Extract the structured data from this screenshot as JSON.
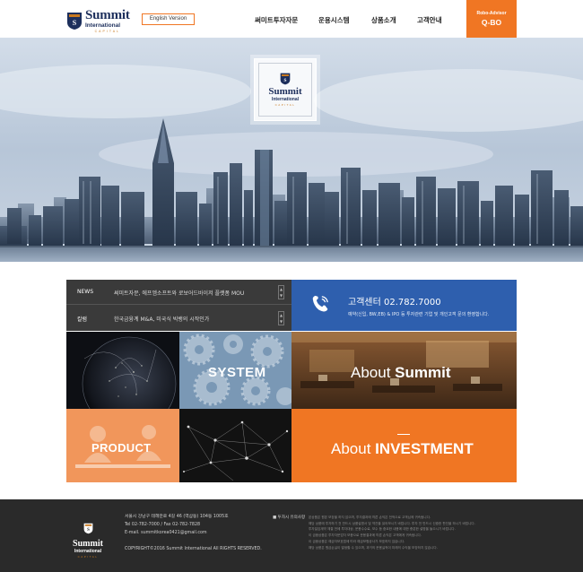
{
  "header": {
    "logo": {
      "main": "Summit",
      "sub": "International",
      "tiny": "CAPITAL"
    },
    "english_button": "English Version",
    "nav": [
      "써미트투자자문",
      "운용시스템",
      "상품소개",
      "고객안내"
    ],
    "robo": {
      "small": "Robo-Advisor",
      "big": "Q-BO"
    }
  },
  "hero": {
    "logo": {
      "main": "Summit",
      "sub": "International",
      "tiny": "CAPITAL"
    }
  },
  "news": {
    "rows": [
      {
        "category": "NEWS",
        "title": "써미트자문, 에프엠소프트와 로보어드바이저 플랫폼 MOU"
      },
      {
        "category": "칼럼",
        "title": "한국금융계 M&A, 미국식 빅뱅의 시작인가"
      }
    ]
  },
  "call_center": {
    "title": "고객센터 02.782.7000",
    "desc": "예약(신입, BW,EB) & IPO 등 투자관련 기업 및 개인고객 문의 환영합니다."
  },
  "tiles": {
    "system": "SYSTEM",
    "about_summit_prefix": "About ",
    "about_summit_bold": "Summit",
    "product": "PRODUCT",
    "about_invest_prefix": "About ",
    "about_invest_bold": "INVESTMENT"
  },
  "footer": {
    "logo": {
      "main": "Summit",
      "sub": "International",
      "tiny": "CAPITAL"
    },
    "address": "서울시 강남구 테헤란로 4길 46 (역삼동) 104동 1005호",
    "tel": "Tel 02-782-7000  /  Fax 02-782-7828",
    "email": "E-mail. summitkorea0421@gmail.com",
    "copyright": "COPYRIGHT©2016 Summit International All RIGHTS RESERVED.",
    "section_title": "■ 투자시 유의사항",
    "disclaimer": [
      "본상품은 원본 보장을 하지 않으며, 투자결과에 따른 손익은 전적으로 고객님께 귀속됩니다.",
      "해당 상품에 투자하기 전 반드시 상품설명서 및 약관을 읽어보시기 바랍니다. 투자 전 반드시 신중한 판단을 하시기 바랍니다.",
      "투자일임계약 체결 전에 투자대상, 운용수수료, 보수 등 중요한 내용에 대한 충분한 설명을 들으시기 바랍니다.",
      "이 금융상품은 투자자문업자 보증으로 운용결과에 따른 손익은 고객에게 귀속됩니다.",
      "이 금융상품은 예금자보호법에 따라 예금보험공사가 보호하지 않습니다.",
      "해당 상품은 원금손실이 발생할 수 있으며, 과거의 운용실적이 미래의 수익을 보장하지 않습니다."
    ]
  },
  "colors": {
    "accent": "#f07623",
    "navy": "#1d2f5c",
    "blue": "#2e5fae",
    "dark": "#3a3a3a",
    "footer": "#2a2a2a"
  }
}
